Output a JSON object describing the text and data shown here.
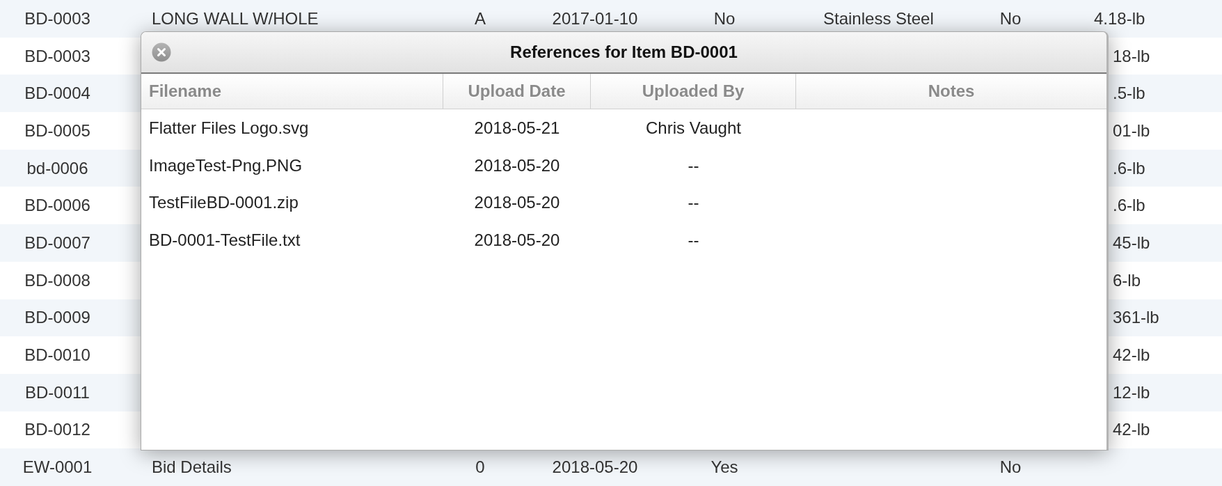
{
  "background_table": {
    "rows": [
      {
        "column_1": "BD-0003",
        "column_2": "LONG WALL W/HOLE",
        "column_3": "A",
        "column_4": "2017-01-10",
        "column_5": "No",
        "column_6": "Stainless Steel",
        "column_7": "No",
        "column_8": "4.18-lb"
      },
      {
        "column_1": "BD-0003",
        "column_8": "18-lb"
      },
      {
        "column_1": "BD-0004",
        "column_8": ".5-lb"
      },
      {
        "column_1": "BD-0005",
        "column_8": "01-lb"
      },
      {
        "column_1": "bd-0006",
        "column_8": ".6-lb"
      },
      {
        "column_1": "BD-0006",
        "column_8": ".6-lb"
      },
      {
        "column_1": "BD-0007",
        "column_8": "45-lb"
      },
      {
        "column_1": "BD-0008",
        "column_8": "6-lb"
      },
      {
        "column_1": "BD-0009",
        "column_8": "361-lb"
      },
      {
        "column_1": "BD-0010",
        "column_8": "42-lb"
      },
      {
        "column_1": "BD-0011",
        "column_8": "12-lb"
      },
      {
        "column_1": "BD-0012",
        "column_8": "42-lb"
      },
      {
        "column_1": "EW-0001",
        "column_2": "Bid Details",
        "column_3": "0",
        "column_4": "2018-05-20",
        "column_5": "Yes",
        "column_7": "No"
      }
    ]
  },
  "dialog": {
    "title": "References for Item BD-0001",
    "columns": [
      "Filename",
      "Upload Date",
      "Uploaded By",
      "Notes"
    ],
    "rows": [
      {
        "filename": "Flatter Files Logo.svg",
        "upload_date": "2018-05-21",
        "uploaded_by": "Chris Vaught"
      },
      {
        "filename": "ImageTest-Png.PNG",
        "upload_date": "2018-05-20",
        "uploaded_by": "--"
      },
      {
        "filename": "TestFileBD-0001.zip",
        "upload_date": "2018-05-20",
        "uploaded_by": "--"
      },
      {
        "filename": "BD-0001-TestFile.txt",
        "upload_date": "2018-05-20",
        "uploaded_by": "--"
      }
    ]
  }
}
